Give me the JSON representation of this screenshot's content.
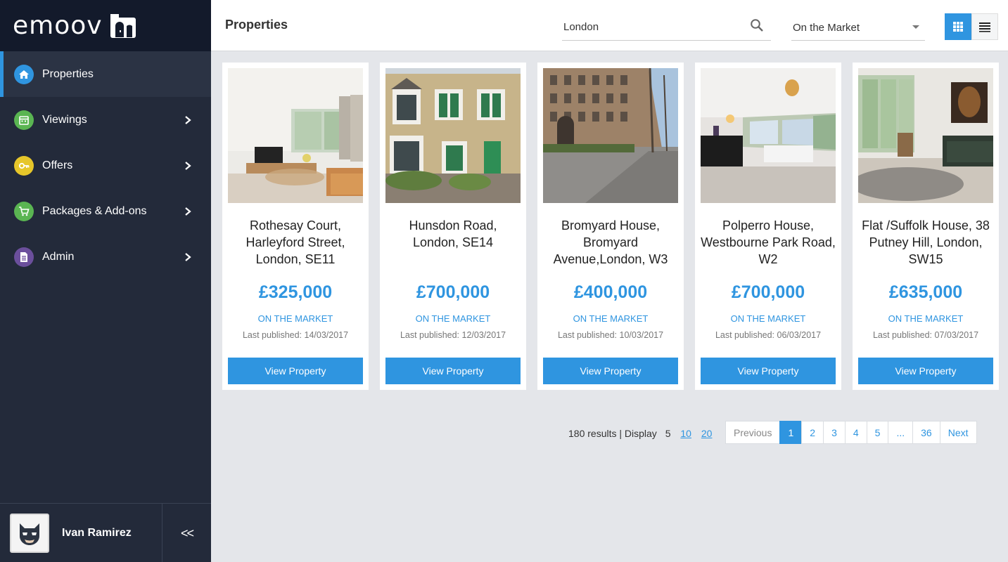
{
  "brand": {
    "logo_text": "emoov"
  },
  "sidebar": {
    "items": [
      {
        "label": "Properties",
        "icon": "home-icon",
        "color": "#2f95e0",
        "active": true
      },
      {
        "label": "Viewings",
        "icon": "calendar-icon",
        "color": "#5ab552",
        "active": false
      },
      {
        "label": "Offers",
        "icon": "key-icon",
        "color": "#e6c62a",
        "active": false
      },
      {
        "label": "Packages & Add-ons",
        "icon": "cart-icon",
        "color": "#5ab552",
        "active": false
      },
      {
        "label": "Admin",
        "icon": "document-icon",
        "color": "#6b4f9c",
        "active": false
      }
    ],
    "user": {
      "name": "Ivan Ramirez",
      "avatar_icon": "batman-avatar-icon"
    },
    "collapse_label": "<<"
  },
  "header": {
    "title": "Properties",
    "search": {
      "value": "London",
      "placeholder": ""
    },
    "status_filter": {
      "selected": "On the Market"
    },
    "view_modes": [
      "grid",
      "list"
    ],
    "active_view": "grid"
  },
  "cards": [
    {
      "address": "Rothesay Court, Harleyford Street, London, SE11",
      "price": "£325,000",
      "status": "ON THE MARKET",
      "published": "Last published: 14/03/2017",
      "button": "View Property"
    },
    {
      "address": "Hunsdon Road, London, SE14",
      "price": "£700,000",
      "status": "ON THE MARKET",
      "published": "Last published: 12/03/2017",
      "button": "View Property"
    },
    {
      "address": "Bromyard House, Bromyard Avenue,London, W3",
      "price": "£400,000",
      "status": "ON THE MARKET",
      "published": "Last published: 10/03/2017",
      "button": "View Property"
    },
    {
      "address": "Polperro House, Westbourne Park Road, W2",
      "price": "£700,000",
      "status": "ON THE MARKET",
      "published": "Last published: 06/03/2017",
      "button": "View Property"
    },
    {
      "address": "Flat /Suffolk House, 38 Putney Hill, London, SW15",
      "price": "£635,000",
      "status": "ON THE MARKET",
      "published": "Last published: 07/03/2017",
      "button": "View Property"
    }
  ],
  "pagination": {
    "results_text": "180 results | Display",
    "display_current": "5",
    "display_options": [
      "10",
      "20"
    ],
    "previous": "Previous",
    "pages": [
      "1",
      "2",
      "3",
      "4",
      "5",
      "...",
      "36"
    ],
    "active_page": "1",
    "next": "Next"
  },
  "colors": {
    "accent": "#2f95e0",
    "sidebar_bg": "#232a3a",
    "logo_bg": "#131a2b"
  }
}
